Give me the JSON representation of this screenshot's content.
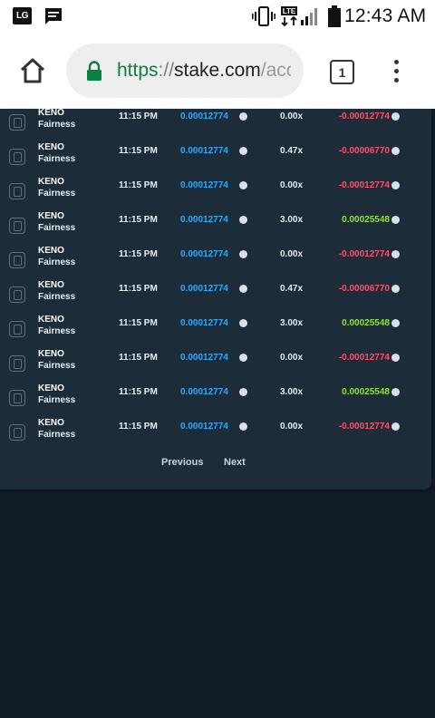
{
  "status_bar": {
    "brand_badge": "LG",
    "time": "12:43 AM",
    "icons": [
      "lg-icon",
      "message-icon",
      "vibrate-icon",
      "lte-icon",
      "signal-icon",
      "battery-icon"
    ]
  },
  "browser": {
    "url_scheme": "https",
    "url_separator": "://",
    "url_host": "stake.com",
    "url_rest": "/acc",
    "tab_count": "1",
    "icons": [
      "home-icon",
      "lock-icon",
      "tabs-icon",
      "overflow-menu-icon"
    ]
  },
  "colors": {
    "positive": "#8ee13a",
    "negative": "#ff4f6b",
    "bet_amount": "#2eaaff",
    "card_bg": "#1c2d39",
    "page_bg": "#101c25"
  },
  "bets": [
    {
      "game": "KENO",
      "link": "Fairness",
      "time": "11:15 PM",
      "bet": "0.00012774",
      "multiplier": "0.00x",
      "payout": "-0.00012774",
      "result": "loss"
    },
    {
      "game": "KENO",
      "link": "Fairness",
      "time": "11:15 PM",
      "bet": "0.00012774",
      "multiplier": "0.47x",
      "payout": "-0.00006770",
      "result": "loss"
    },
    {
      "game": "KENO",
      "link": "Fairness",
      "time": "11:15 PM",
      "bet": "0.00012774",
      "multiplier": "0.00x",
      "payout": "-0.00012774",
      "result": "loss"
    },
    {
      "game": "KENO",
      "link": "Fairness",
      "time": "11:15 PM",
      "bet": "0.00012774",
      "multiplier": "3.00x",
      "payout": "0.00025548",
      "result": "win"
    },
    {
      "game": "KENO",
      "link": "Fairness",
      "time": "11:15 PM",
      "bet": "0.00012774",
      "multiplier": "0.00x",
      "payout": "-0.00012774",
      "result": "loss"
    },
    {
      "game": "KENO",
      "link": "Fairness",
      "time": "11:15 PM",
      "bet": "0.00012774",
      "multiplier": "0.47x",
      "payout": "-0.00006770",
      "result": "loss"
    },
    {
      "game": "KENO",
      "link": "Fairness",
      "time": "11:15 PM",
      "bet": "0.00012774",
      "multiplier": "3.00x",
      "payout": "0.00025548",
      "result": "win"
    },
    {
      "game": "KENO",
      "link": "Fairness",
      "time": "11:15 PM",
      "bet": "0.00012774",
      "multiplier": "0.00x",
      "payout": "-0.00012774",
      "result": "loss"
    },
    {
      "game": "KENO",
      "link": "Fairness",
      "time": "11:15 PM",
      "bet": "0.00012774",
      "multiplier": "3.00x",
      "payout": "0.00025548",
      "result": "win"
    },
    {
      "game": "KENO",
      "link": "Fairness",
      "time": "11:15 PM",
      "bet": "0.00012774",
      "multiplier": "0.00x",
      "payout": "-0.00012774",
      "result": "loss"
    }
  ],
  "pagination": {
    "previous_label": "Previous",
    "next_label": "Next"
  }
}
